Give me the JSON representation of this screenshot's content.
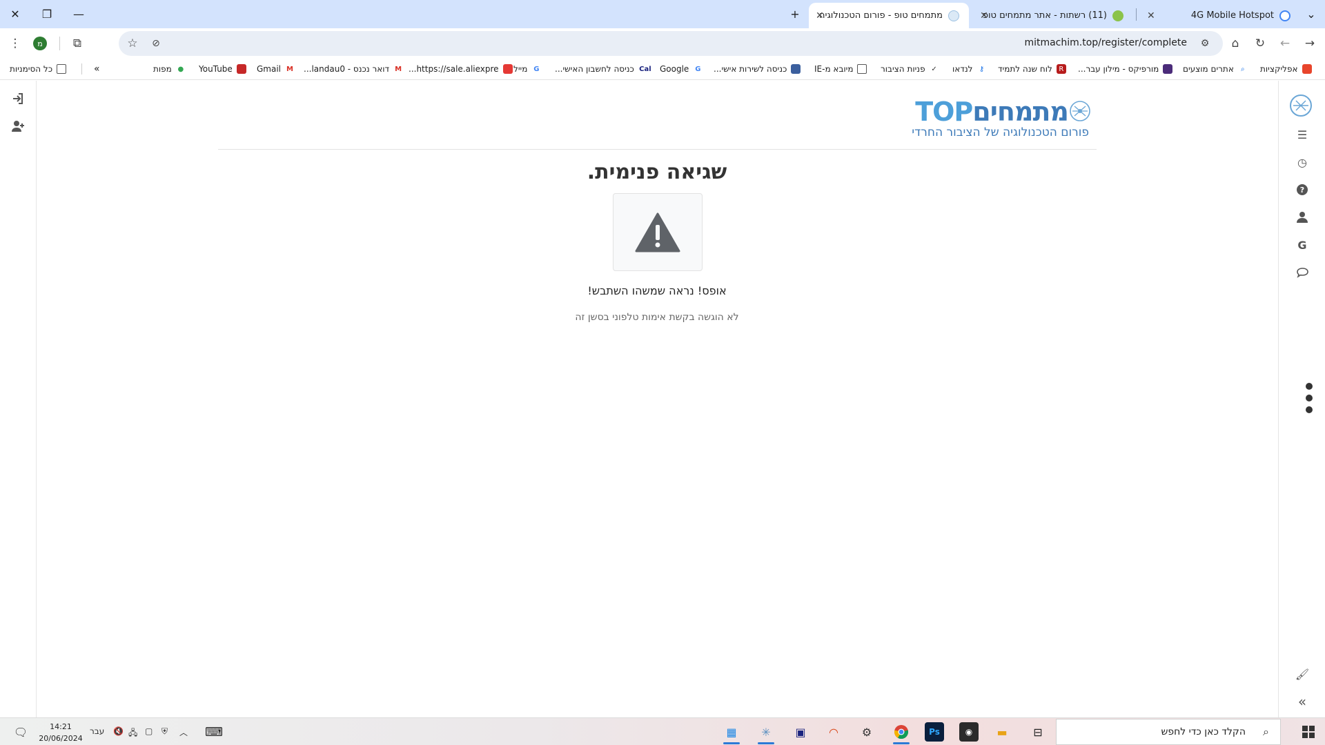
{
  "browser": {
    "tabs": [
      {
        "title": "4G Mobile Hotspot",
        "active": false
      },
      {
        "title": "(11) רשתות - אתר מתמחים טופ",
        "active": false
      },
      {
        "title": "מתמחים טופ - פורום הטכנולוגיה",
        "active": true
      }
    ],
    "new_tab_label": "+",
    "url": "mitmachim.top/register/complete",
    "profile_initial": "מ"
  },
  "bookmarks": {
    "apps": "אפליקציות",
    "items": [
      "אתרים מוצעים",
      "מורפיקס - מילון עבר...",
      "לוח שנה לתמיד",
      "לנדאו",
      "פניות הציבור",
      "מיובא מ-IE",
      "כניסה לשירות אישי...",
      "Google",
      "כניסה לחשבון האישי...",
      "מייל",
      "https://sale.aliexpre...",
      "דואר נכנס - landau0...",
      "Gmail",
      "YouTube",
      "מפות"
    ],
    "overflow": "»",
    "all_bookmarks": "כל הסימניות"
  },
  "logo": {
    "brand_he": "מתמחים",
    "brand_en": "TOP",
    "tagline": "פורום הטכנולוגיה של הציבור החרדי"
  },
  "error": {
    "title": "שגיאה פנימית.",
    "message": "אופס! נראה שמשהו השתבש!",
    "detail": "לא הוגשה בקשת אימות טלפוני בסשן זה"
  },
  "taskbar": {
    "search_placeholder": "הקלד כאן כדי לחפש",
    "time": "14:21",
    "date": "20/06/2024",
    "language": "עבר"
  },
  "colors": {
    "tabstrip": "#d3e3fd",
    "brand_blue": "#3d7ab8",
    "warn_icon": "#5f6368"
  }
}
